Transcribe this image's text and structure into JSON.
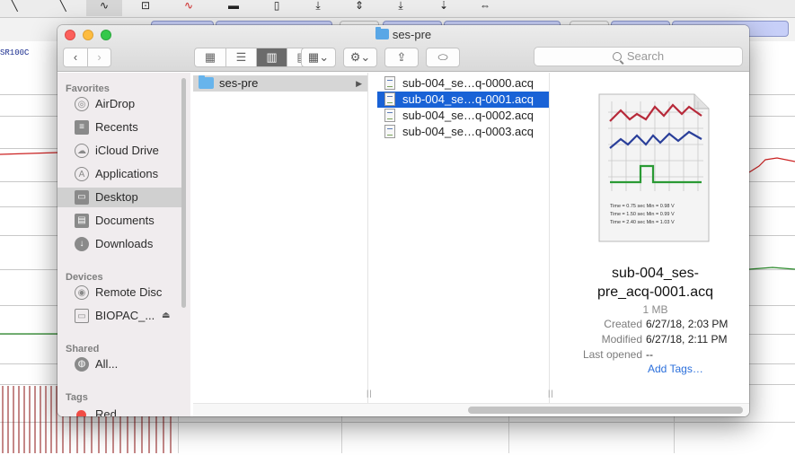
{
  "background_app": {
    "channel_label": "SR100C"
  },
  "window": {
    "title": "ses-pre",
    "title_icon": "folder-icon"
  },
  "toolbar": {
    "back_icon": "‹",
    "forward_icon": "›",
    "views": [
      {
        "name": "icon-view",
        "glyph": "▦"
      },
      {
        "name": "list-view",
        "glyph": "☰"
      },
      {
        "name": "column-view",
        "glyph": "▥"
      },
      {
        "name": "gallery-view",
        "glyph": "▤"
      }
    ],
    "arrange_glyph": "▦⌄",
    "action_glyph": "⚙⌄",
    "share_glyph": "⇪",
    "tag_glyph": "⬭",
    "search_placeholder": "Search"
  },
  "sidebar": {
    "favorites_header": "Favorites",
    "favorites": [
      {
        "label": "AirDrop",
        "icon": "airdrop-icon",
        "glyph": "◎"
      },
      {
        "label": "Recents",
        "icon": "recents-icon",
        "glyph": "≡"
      },
      {
        "label": "iCloud Drive",
        "icon": "cloud-icon",
        "glyph": "☁"
      },
      {
        "label": "Applications",
        "icon": "applications-icon",
        "glyph": "A"
      },
      {
        "label": "Desktop",
        "icon": "desktop-icon",
        "glyph": "▭"
      },
      {
        "label": "Documents",
        "icon": "documents-icon",
        "glyph": "▤"
      },
      {
        "label": "Downloads",
        "icon": "downloads-icon",
        "glyph": "↓"
      }
    ],
    "devices_header": "Devices",
    "devices": [
      {
        "label": "Remote Disc",
        "icon": "disc-icon",
        "glyph": "◉"
      },
      {
        "label": "BIOPAC_...",
        "icon": "drive-icon",
        "glyph": "▭",
        "eject": "⏏"
      }
    ],
    "shared_header": "Shared",
    "shared": [
      {
        "label": "All...",
        "icon": "network-icon",
        "glyph": "◍"
      }
    ],
    "tags_header": "Tags",
    "tags": [
      {
        "label": "Red",
        "color": "#f04c45"
      }
    ]
  },
  "columns": {
    "col1": [
      {
        "label": "ses-pre",
        "chevron": "▶"
      }
    ],
    "col2": [
      {
        "label": "sub-004_se…q-0000.acq"
      },
      {
        "label": "sub-004_se…q-0001.acq"
      },
      {
        "label": "sub-004_se…q-0002.acq"
      },
      {
        "label": "sub-004_se…q-0003.acq"
      }
    ],
    "resize_glyph": "||"
  },
  "preview": {
    "name_line1": "sub-004_ses-",
    "name_line2": "pre_acq-0001.acq",
    "size": "1 MB",
    "meta": [
      {
        "label": "Created",
        "value": "6/27/18, 2:03 PM"
      },
      {
        "label": "Modified",
        "value": "6/27/18, 2:11 PM"
      },
      {
        "label": "Last opened",
        "value": "--"
      }
    ],
    "add_tags": "Add Tags…",
    "thumb_lines": [
      "Time = 0.75 sec   Min = 0.98 V",
      "Time = 1.50 sec   Min = 0.99 V",
      "Time = 2.40 sec   Min = 1.03 V"
    ]
  }
}
